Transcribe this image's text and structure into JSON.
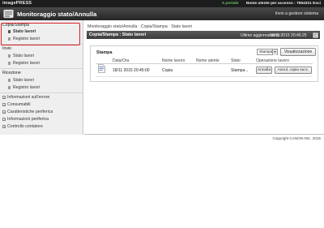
{
  "topbar": {
    "logo": "imagePRESS",
    "portal_link": "A portale",
    "user_text": "Nome utente per accesso : 7654321 Esci"
  },
  "header": {
    "title": "Monitoraggio stato/Annulla",
    "back_link": "Invio a gestore sistema"
  },
  "sidebar": {
    "groups": [
      {
        "label": "Copia/Stampa",
        "items": [
          {
            "label": "Stato lavori",
            "active": true
          },
          {
            "label": "Registro lavori",
            "active": false
          }
        ]
      },
      {
        "label": "Invio",
        "items": [
          {
            "label": "Stato lavori"
          },
          {
            "label": "Registro lavori"
          }
        ]
      },
      {
        "label": "Ricezione",
        "items": [
          {
            "label": "Stato lavori"
          },
          {
            "label": "Registro lavori"
          }
        ]
      }
    ],
    "expandables": [
      "Informazioni sull'errore",
      "Consumabili",
      "Caratteristiche periferica",
      "Informazioni periferica",
      "Controllo contatore"
    ]
  },
  "breadcrumb": [
    "Monitoraggio stato/Annulla",
    "Copia/Stampa",
    "Stato lavori"
  ],
  "status_header": {
    "title": "Copia/Stampa : Stato lavori",
    "update_label": "Ultimo aggiornamento :",
    "update_value": "18/11 2015 20:45:25",
    "refresh_icon": "refresh-icon"
  },
  "print_panel": {
    "title": "Stampa",
    "filter_value": "Stampa",
    "view_button": "Visualizzazione",
    "columns": [
      "Data/Ora",
      "Nome lavoro",
      "Nome utente",
      "Stato",
      "Operazione lavoro"
    ],
    "rows": [
      {
        "date": "18/11 2015 20:45:00",
        "job_name": "Copia",
        "user_name": "",
        "status": "Stampa...",
        "cancel_label": "Annulla",
        "cancel_after_label": "Annul. copia succ."
      }
    ]
  },
  "footer": {
    "copyright": "Copyright CANON INC. 2015"
  },
  "colors": {
    "accent_red": "#d9202a",
    "portal_green": "#66c25e",
    "header_dark": "#262626"
  }
}
